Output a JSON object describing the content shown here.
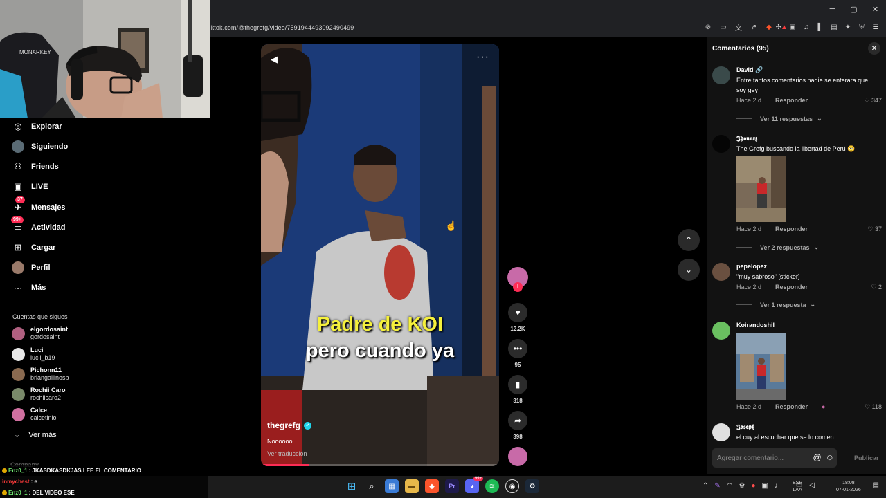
{
  "browser": {
    "url": "tiktok.com/@thegrefg/video/7591944493092490499",
    "window_controls": [
      "─",
      "▢",
      "✕"
    ],
    "notification_count": "1"
  },
  "sidebar": {
    "items": [
      {
        "label": "Explorar",
        "icon": "compass-icon",
        "glyph": "◎"
      },
      {
        "label": "Siguiendo",
        "icon": "following-avatar-icon",
        "glyph": "●"
      },
      {
        "label": "Friends",
        "icon": "friends-icon",
        "glyph": "⚇"
      },
      {
        "label": "LIVE",
        "icon": "live-tv-icon",
        "glyph": "▣"
      },
      {
        "label": "Mensajes",
        "icon": "messages-icon",
        "glyph": "✈",
        "badge": "37"
      },
      {
        "label": "Actividad",
        "icon": "activity-icon",
        "glyph": "▭",
        "badge": "99+"
      },
      {
        "label": "Cargar",
        "icon": "upload-icon",
        "glyph": "⊞"
      },
      {
        "label": "Perfil",
        "icon": "profile-avatar-icon",
        "glyph": "●"
      },
      {
        "label": "Más",
        "icon": "more-dots-icon",
        "glyph": "···"
      }
    ],
    "following_title": "Cuentas que sigues",
    "accounts": [
      {
        "name": "elgordosaint",
        "handle": "gordosaint",
        "color": "#b06080"
      },
      {
        "name": "Luci",
        "handle": "lucii_b19",
        "color": "#e8e8e8"
      },
      {
        "name": "Pichonn11",
        "handle": "briangallinosb",
        "color": "#8a6a50"
      },
      {
        "name": "Rochii Caro",
        "handle": "rochiicaro2",
        "color": "#7a8a6a"
      },
      {
        "name": "Calce",
        "handle": "calcetinlol",
        "color": "#d070a0"
      }
    ],
    "ver_mas": "Ver más",
    "company": "Company"
  },
  "chat": [
    {
      "user": "Enz0_1",
      "text": ": JKASDKASDKJAS LEE EL COMENTARIO",
      "user_color": "#6fe36f",
      "badge": true
    },
    {
      "user": "inmychest",
      "text": ": e",
      "user_color": "#ff3b3b",
      "badge": false
    },
    {
      "user": "Enz0_1",
      "text": ": DEL VIDEO ESE",
      "user_color": "#6fe36f",
      "badge": true
    }
  ],
  "video": {
    "caption_line1": "Padre de KOI",
    "caption_line2": "pero cuando ya",
    "author": "thegrefg",
    "description": "Noooooo",
    "translate": "Ver traducción",
    "progress": 0.2
  },
  "actions": {
    "likes": "12.2K",
    "comments": "95",
    "saves": "318",
    "shares": "398"
  },
  "comments_panel": {
    "title": "Comentarios (95)",
    "items": [
      {
        "user": "David 🔗",
        "text": "Entre tantos comentarios nadie se enterara que soy gey",
        "time": "Hace 2 d",
        "reply": "Responder",
        "likes": "347",
        "thread": "Ver 11 respuestas",
        "avatar": "#3a4a4a"
      },
      {
        "user": "𝕵𝖍𝖔𝖓𝖓𝖝𝖟",
        "text": "The Grefg buscando la libertad de Perú 🥺",
        "time": "Hace 2 d",
        "reply": "Responder",
        "likes": "37",
        "thread": "Ver 2 respuestas",
        "avatar": "#050505"
      },
      {
        "user": "pepelopez",
        "text": "\"muy sabroso\" [sticker]",
        "time": "Hace 2 d",
        "reply": "Responder",
        "likes": "2",
        "thread": "Ver 1 respuesta",
        "avatar": "#6a5040"
      },
      {
        "user": "Koirandoshil",
        "text": "",
        "time": "Hace 2 d",
        "reply": "Responder",
        "likes": "118",
        "thread": "",
        "avatar": "#6ac060"
      },
      {
        "user": "𝕵𝖔𝖘𝖊𝖕𝖍",
        "text": "el cuy al escuchar que se lo comen",
        "time": "",
        "reply": "",
        "likes": "",
        "thread": "",
        "avatar": "#e0e0e0"
      }
    ],
    "input_placeholder": "Agregar comentario...",
    "publish": "Publicar"
  },
  "taskbar": {
    "lang_line1": "ESP",
    "lang_line2": "LAA",
    "time": "18:08",
    "date": "07-01-2026",
    "notif": "99+"
  }
}
